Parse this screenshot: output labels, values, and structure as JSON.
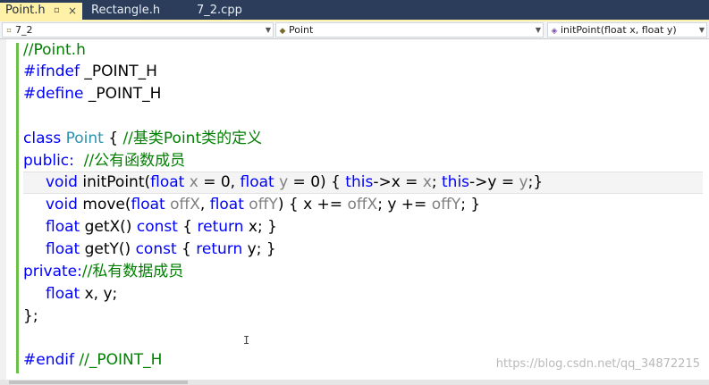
{
  "tabs": [
    {
      "label": "Point.h",
      "pin": "pin-icon",
      "close": "×"
    },
    {
      "label": "Rectangle.h"
    },
    {
      "label": "7_2.cpp"
    }
  ],
  "navbar": {
    "project": "7_2",
    "class": "Point",
    "member": "initPoint(float x, float y)"
  },
  "code": {
    "l1": {
      "cm": "//Point.h"
    },
    "l2": {
      "kw": "#ifndef",
      "rest": " _POINT_H"
    },
    "l3": {
      "kw": "#define",
      "rest": " _POINT_H"
    },
    "l5": {
      "kw": "class",
      "ty": " Point",
      "rest": " { ",
      "cm": "//基类Point类的定义"
    },
    "l6": {
      "kw": "public:",
      "rest": "  ",
      "cm": "//公有函数成员"
    },
    "l7": {
      "kw1": "void",
      "t1": " initPoint(",
      "kw2": "float",
      "p1": " x",
      "t2": " = 0, ",
      "kw3": "float",
      "p2": " y",
      "t3": " = 0) { ",
      "kw4": "this",
      "t4": "->x = ",
      "p3": "x",
      "t5": "; ",
      "kw5": "this",
      "t6": "->y = ",
      "p4": "y",
      "t7": ";}"
    },
    "l8": {
      "kw1": "void",
      "t1": " move(",
      "kw2": "float",
      "p1": " offX",
      "t2": ", ",
      "kw3": "float",
      "p2": " offY",
      "t3": ") { x += ",
      "p3": "offX",
      "t4": "; y += ",
      "p4": "offY",
      "t5": "; }"
    },
    "l9": {
      "kw1": "float",
      "t1": " getX() ",
      "kw2": "const",
      "t2": " { ",
      "kw3": "return",
      "t3": " x; }"
    },
    "l10": {
      "kw1": "float",
      "t1": " getY() ",
      "kw2": "const",
      "t2": " { ",
      "kw3": "return",
      "t3": " y; }"
    },
    "l11": {
      "kw": "private:",
      "cm": "//私有数据成员"
    },
    "l12": {
      "kw": "float",
      "rest": " x, y;"
    },
    "l13": {
      "rest": "};"
    },
    "l15": {
      "kw": "#endif",
      "rest": " ",
      "cm": "//_POINT_H"
    }
  },
  "watermark": "https://blog.csdn.net/qq_34872215",
  "colors": {
    "keyword": "#0000ff",
    "comment": "#008000",
    "type": "#2b91af",
    "parameter": "#808080",
    "active_tab": "#fff1a8",
    "tab_strip": "#2b3d5a",
    "change_bar": "#6cc04a"
  }
}
